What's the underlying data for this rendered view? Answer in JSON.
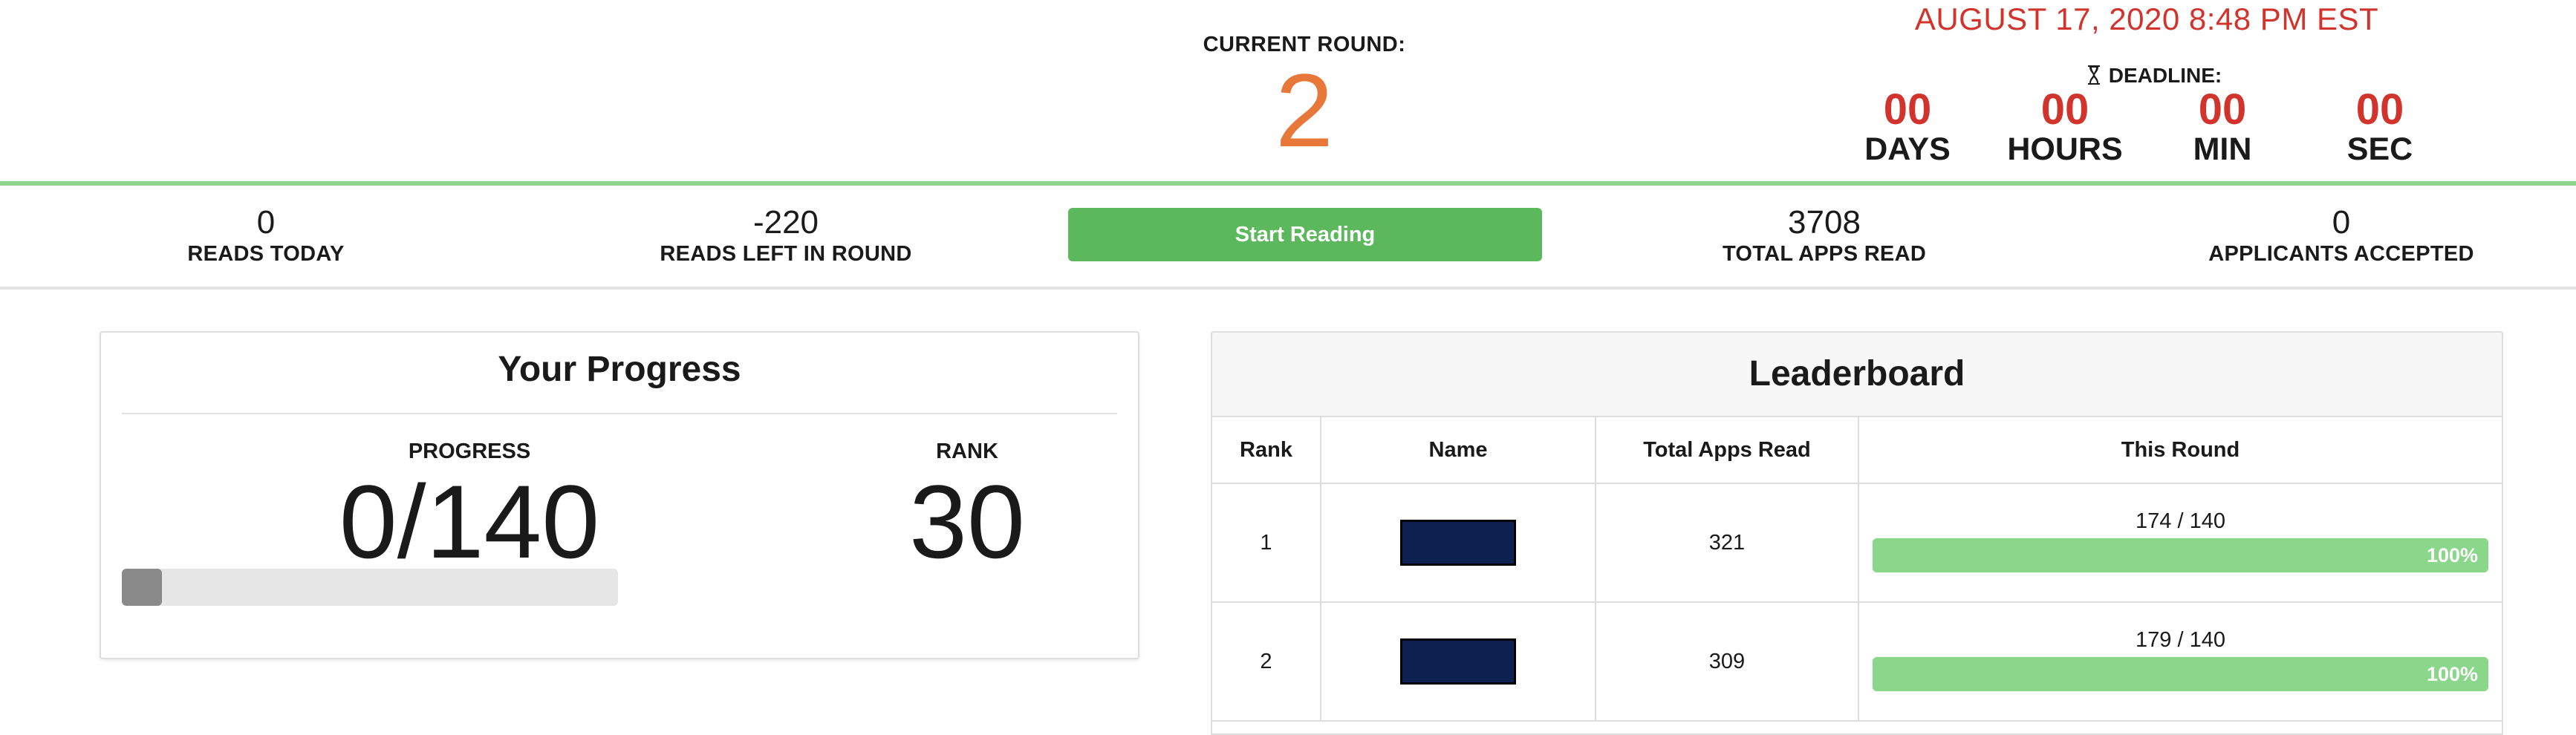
{
  "header": {
    "current_round_label": "CURRENT ROUND:",
    "current_round_value": "2",
    "date_time": "AUGUST 17, 2020 8:48 PM EST",
    "deadline_label": "DEADLINE:",
    "countdown": [
      {
        "value": "00",
        "unit": "DAYS"
      },
      {
        "value": "00",
        "unit": "HOURS"
      },
      {
        "value": "00",
        "unit": "MIN"
      },
      {
        "value": "00",
        "unit": "SEC"
      }
    ]
  },
  "stats": {
    "reads_today": {
      "value": "0",
      "label": "READS TODAY"
    },
    "reads_left": {
      "value": "-220",
      "label": "READS LEFT IN ROUND"
    },
    "start_button_label": "Start Reading",
    "total_apps_read": {
      "value": "3708",
      "label": "TOTAL APPS READ"
    },
    "applicants_accepted": {
      "value": "0",
      "label": "APPLICANTS ACCEPTED"
    }
  },
  "progress_card": {
    "title": "Your Progress",
    "progress_label": "PROGRESS",
    "progress_value": "0/140",
    "progress_fraction": 0,
    "rank_label": "RANK",
    "rank_value": "30"
  },
  "leaderboard": {
    "title": "Leaderboard",
    "columns": [
      "Rank",
      "Name",
      "Total Apps Read",
      "This Round"
    ],
    "rows": [
      {
        "rank": "1",
        "name": "",
        "total": "321",
        "round_count": "174 / 140",
        "percent_label": "100%",
        "percent": 100
      },
      {
        "rank": "2",
        "name": "",
        "total": "309",
        "round_count": "179 / 140",
        "percent_label": "100%",
        "percent": 100
      }
    ]
  },
  "colors": {
    "accent_orange": "#e8773a",
    "deadline_red": "#d0342c",
    "start_button_green": "#5cb85c",
    "header_rule_green": "#8fd48b",
    "bar_green": "#8ad68a",
    "redacted_navy": "#0c2150"
  },
  "icons": {
    "deadline": "hourglass-icon"
  }
}
